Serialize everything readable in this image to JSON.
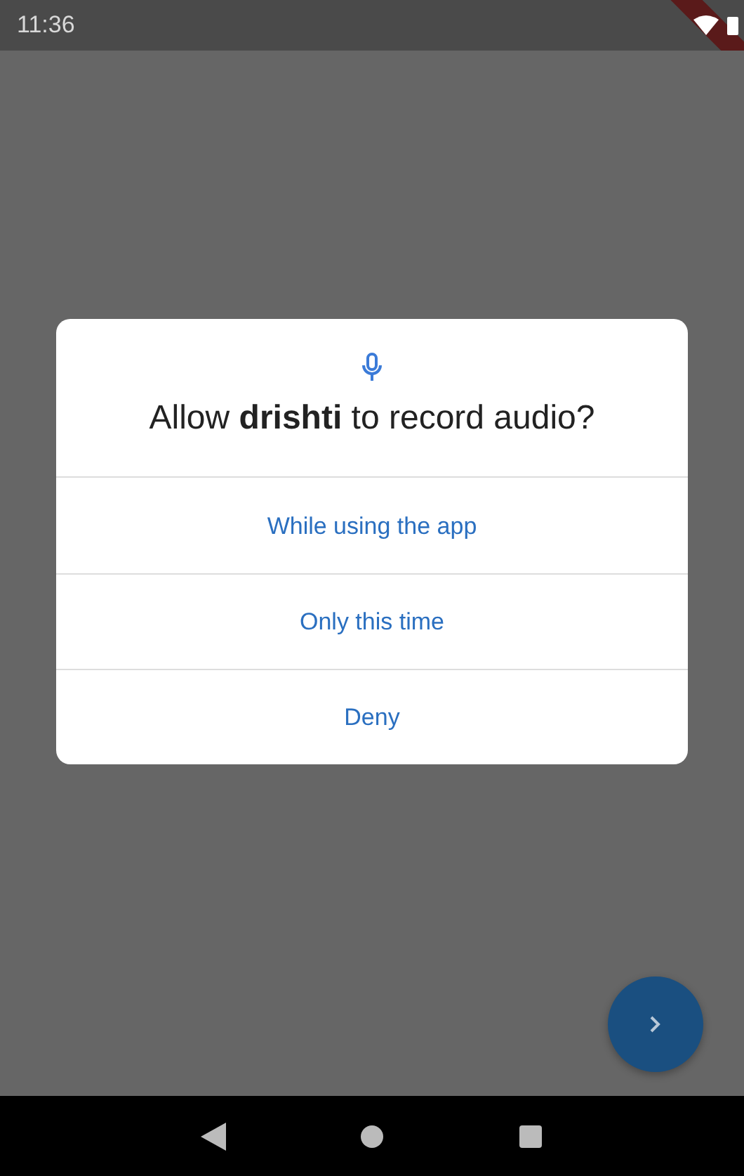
{
  "status_bar": {
    "time": "11:36"
  },
  "dialog": {
    "title": "Allow **drishti** to record audio?",
    "options": [
      {
        "label": "While using the app"
      },
      {
        "label": "Only this time"
      },
      {
        "label": "Deny"
      }
    ]
  }
}
